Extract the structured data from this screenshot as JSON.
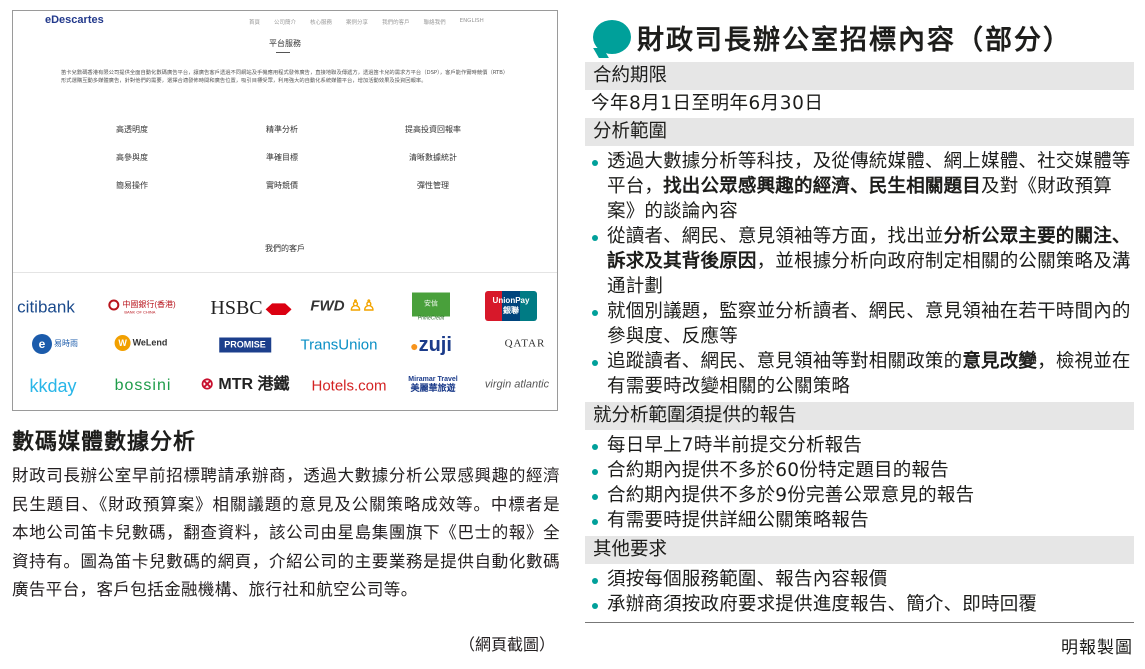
{
  "screenshot": {
    "logo": "eDescartes",
    "nav": [
      "首頁",
      "公司簡介",
      "核心服務",
      "案例分享",
      "我們的客戶",
      "聯絡我們",
      "ENGLISH"
    ],
    "section_title": "平台服務",
    "intro": "笛卡兒數碼香港有限公司提供全面自動化數碼廣告平台，讓廣告客戶透過不同網站及手機應用程式發佈廣告，直接地聯及傳遞方，透過笛卡兒的需求方平台（DSP），客戶能作實時競價（RTB）形式選購互動多媒體廣告，針對他們的需要，選擇合適發佈時間和廣告位置，吸引目標受眾，利用強大的自動化系統媒體平台，增加活動效果及投資回報率。",
    "features": [
      "高透明度",
      "精準分析",
      "提高投資回報率",
      "高參與度",
      "準確目標",
      "清晰數據統計",
      "簡易操作",
      "實時競價",
      "彈性管理"
    ],
    "clients_title": "我們的客戶",
    "clients": {
      "citi": "citibank",
      "boc": "中國銀行(香港)",
      "boc_en": "BANK OF CHINA",
      "hsbc": "HSBC",
      "fwd": "FWD",
      "prime": "安信",
      "prime_en": "PrimeCredit",
      "unionpay": "UnionPay",
      "unionpay_cn": "銀聯",
      "egg": "易時雨",
      "welend": "WeLend",
      "promise": "PROMISE",
      "transunion": "TransUnion",
      "zuji": "zuji",
      "qatar": "QATAR",
      "kkday": "kkday",
      "bossini": "bossini",
      "mtr": "MTR 港鐵",
      "hotels": "Hotels.com",
      "miramar": "Miramar Travel",
      "miramar_cn": "美麗華旅遊",
      "virgin": "virgin atlantic"
    }
  },
  "article": {
    "title": "數碼媒體數據分析",
    "body": "財政司長辦公室早前招標聘請承辦商，透過大數據分析公眾感興趣的經濟民生題目、《財政預算案》相關議題的意見及公關策略成效等。中標者是本地公司笛卡兒數碼，翻查資料，該公司由星島集團旗下《巴士的報》全資持有。圖為笛卡兒數碼的網頁，介紹公司的主要業務是提供自動化數碼廣告平台，客戶包括金融機構、旅行社和航空公司等。",
    "caption": "（網頁截圖）"
  },
  "panel": {
    "title": "財政司長辦公室招標內容（部分）",
    "sections": {
      "period": {
        "heading": "合約期限",
        "line": "今年8月1日至明年6月30日"
      },
      "scope": {
        "heading": "分析範圍",
        "items": [
          [
            "透過大數據分析等科技，及從傳統媒體、網上媒體、社交媒體等平台，",
            "找出公眾感興趣的經濟、民生相關題目",
            "及對《財政預算案》的談論內容"
          ],
          [
            "從讀者、網民、意見領袖等方面，找出並",
            "分析公眾主要的關注、訴求及其背後原因",
            "，並根據分析向政府制定相關的公關策略及溝通計劃"
          ],
          [
            "就個別議題，監察並分析讀者、網民、意見領袖在若干時間內的參與度、反應等",
            "",
            ""
          ],
          [
            "追蹤讀者、網民、意見領袖等對相關政策的",
            "意見改變",
            "，檢視並在有需要時改變相關的公關策略"
          ]
        ]
      },
      "reports": {
        "heading": "就分析範圍須提供的報告",
        "items": [
          "每日早上7時半前提交分析報告",
          "合約期內提供不多於60份特定題目的報告",
          "合約期內提供不多於9份完善公眾意見的報告",
          "有需要時提供詳細公關策略報告"
        ]
      },
      "other": {
        "heading": "其他要求",
        "items": [
          "須按每個服務範圍、報告內容報價",
          "承辦商須按政府要求提供進度報告、簡介、即時回覆"
        ]
      }
    },
    "credit": "明報製圖"
  },
  "colors": {
    "accent": "#00a09a",
    "section_bg": "#e6e6e6"
  }
}
